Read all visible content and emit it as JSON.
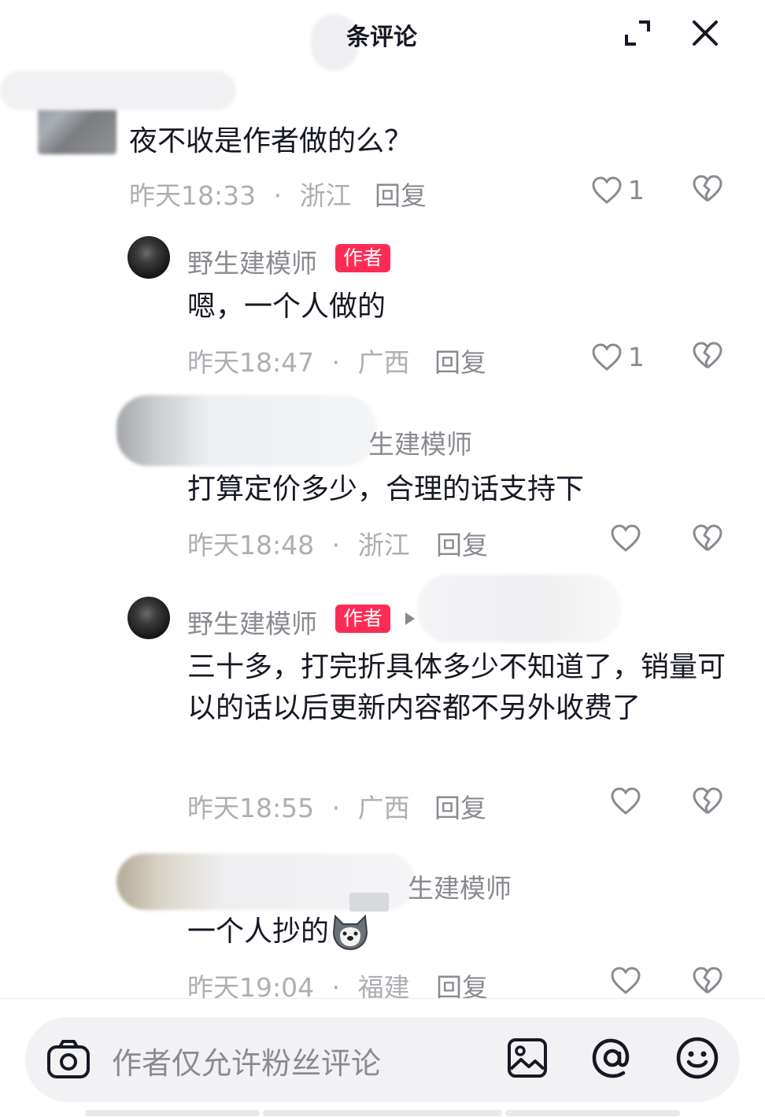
{
  "header": {
    "title": "条评论",
    "expand_icon": "expand-icon",
    "close_icon": "close-icon"
  },
  "comments": [
    {
      "name": "",
      "text": "夜不收是作者做的么？",
      "time": "昨天18:33",
      "location": "浙江",
      "reply_label": "回复",
      "likes": "1"
    }
  ],
  "replies": [
    {
      "name": "野生建模师",
      "tag": "作者",
      "text": "嗯，一个人做的",
      "time": "昨天18:47",
      "location": "广西",
      "reply_label": "回复",
      "likes": "1"
    },
    {
      "name": "生建模师",
      "text": "打算定价多少，合理的话支持下",
      "time": "昨天18:48",
      "location": "浙江",
      "reply_label": "回复",
      "likes": ""
    },
    {
      "name": "野生建模师",
      "tag": "作者",
      "text": "三十多，打完折具体多少不知道了，销量可以的话以后更新内容都不另外收费了",
      "time": "昨天18:55",
      "location": "广西",
      "reply_label": "回复",
      "likes": ""
    },
    {
      "name": "生建模师",
      "text": "一个人抄的",
      "time": "昨天19:04",
      "location": "福建",
      "reply_label": "回复",
      "likes": ""
    }
  ],
  "meta_separator": "·",
  "composer": {
    "placeholder": "作者仅允许粉丝评论",
    "camera_icon": "camera-icon",
    "image_icon": "image-icon",
    "at_icon": "at-icon",
    "emoji_icon": "emoji-icon"
  },
  "colors": {
    "author_tag": "#fe2c55",
    "text": "#161823",
    "muted": "#8a8b91"
  }
}
